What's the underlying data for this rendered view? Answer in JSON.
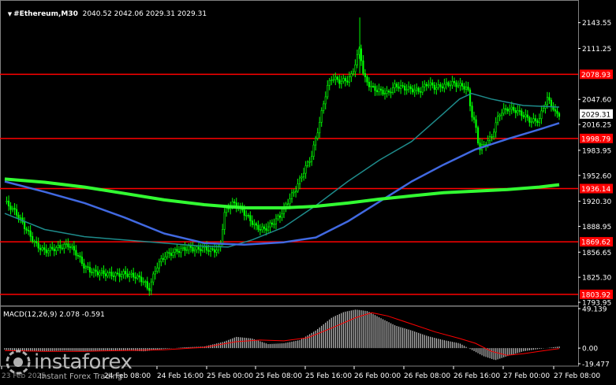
{
  "header": {
    "symbol": "#Ethereum,M30",
    "ohlc": "2040.52 2042.06 2029.31 2029.31"
  },
  "macd_header": "MACD(12,26,9) 2.078 -0.591",
  "watermark": {
    "brand": "instaforex",
    "tagline": "Instant Forex Trading"
  },
  "colors": {
    "background": "#000000",
    "candle": "#00ff00",
    "level_line": "#ff0000",
    "ma_fast": "#1e8b8b",
    "ma_mid": "#4169e1",
    "ma_slow": "#32ff32",
    "macd_hist": "#c0c0c0",
    "macd_signal": "#ff0000"
  },
  "chart_data": [
    {
      "type": "line",
      "subtype": "candlestick",
      "title": "#Ethereum,M30",
      "ylim": [
        1793.95,
        2160
      ],
      "y_ticks": [
        "2143.55",
        "2111.25",
        "2078.93",
        "2047.60",
        "2029.31",
        "2016.25",
        "1998.79",
        "1983.95",
        "1952.60",
        "1936.14",
        "1920.30",
        "1888.95",
        "1869.62",
        "1856.65",
        "1825.30",
        "1803.92",
        "1793.95"
      ],
      "x_ticks": [
        "23 Feb 2025",
        "24 Feb 08:00",
        "24 Feb 16:00",
        "25 Feb 00:00",
        "25 Feb 08:00",
        "25 Feb 16:00",
        "26 Feb 00:00",
        "26 Feb 08:00",
        "26 Feb 16:00",
        "27 Feb 00:00",
        "27 Feb 08:00"
      ],
      "price_path": [
        [
          0,
          1920
        ],
        [
          3,
          1905
        ],
        [
          6,
          1880
        ],
        [
          8,
          1865
        ],
        [
          10,
          1858
        ],
        [
          13,
          1862
        ],
        [
          16,
          1866
        ],
        [
          18,
          1855
        ],
        [
          20,
          1838
        ],
        [
          22,
          1832
        ],
        [
          25,
          1830
        ],
        [
          28,
          1828
        ],
        [
          30,
          1830
        ],
        [
          33,
          1826
        ],
        [
          35,
          1820
        ],
        [
          36,
          1808
        ],
        [
          38,
          1838
        ],
        [
          40,
          1852
        ],
        [
          43,
          1858
        ],
        [
          46,
          1862
        ],
        [
          48,
          1860
        ],
        [
          50,
          1862
        ],
        [
          52,
          1858
        ],
        [
          54,
          1862
        ],
        [
          55,
          1905
        ],
        [
          57,
          1918
        ],
        [
          59,
          1912
        ],
        [
          61,
          1900
        ],
        [
          63,
          1888
        ],
        [
          65,
          1885
        ],
        [
          67,
          1892
        ],
        [
          69,
          1902
        ],
        [
          71,
          1920
        ],
        [
          73,
          1936
        ],
        [
          75,
          1958
        ],
        [
          77,
          1978
        ],
        [
          78,
          2000
        ],
        [
          79,
          2020
        ],
        [
          80,
          2045
        ],
        [
          81,
          2065
        ],
        [
          82,
          2075
        ],
        [
          84,
          2070
        ],
        [
          86,
          2072
        ],
        [
          87,
          2078
        ],
        [
          88,
          2095
        ],
        [
          89,
          2112
        ],
        [
          90,
          2075
        ],
        [
          92,
          2062
        ],
        [
          94,
          2058
        ],
        [
          96,
          2055
        ],
        [
          98,
          2065
        ],
        [
          100,
          2062
        ],
        [
          102,
          2060
        ],
        [
          104,
          2058
        ],
        [
          106,
          2068
        ],
        [
          108,
          2062
        ],
        [
          110,
          2065
        ],
        [
          112,
          2068
        ],
        [
          114,
          2065
        ],
        [
          116,
          2062
        ],
        [
          117,
          2030
        ],
        [
          118,
          2015
        ],
        [
          119,
          1985
        ],
        [
          120,
          1990
        ],
        [
          122,
          2000
        ],
        [
          124,
          2030
        ],
        [
          126,
          2036
        ],
        [
          128,
          2034
        ],
        [
          130,
          2028
        ],
        [
          132,
          2020
        ],
        [
          134,
          2022
        ],
        [
          135,
          2038
        ],
        [
          136,
          2048
        ],
        [
          137,
          2042
        ],
        [
          138,
          2030
        ],
        [
          139,
          2029.31
        ]
      ],
      "series": [
        {
          "name": "MA fast",
          "values": [
            [
              0,
              1905
            ],
            [
              10,
              1885
            ],
            [
              20,
              1876
            ],
            [
              30,
              1872
            ],
            [
              40,
              1868
            ],
            [
              50,
              1864
            ],
            [
              56,
              1863
            ],
            [
              62,
              1872
            ],
            [
              70,
              1888
            ],
            [
              78,
              1915
            ],
            [
              86,
              1945
            ],
            [
              94,
              1972
            ],
            [
              102,
              1995
            ],
            [
              110,
              2030
            ],
            [
              114,
              2048
            ],
            [
              117,
              2055
            ],
            [
              122,
              2048
            ],
            [
              130,
              2040
            ],
            [
              139,
              2038
            ]
          ]
        },
        {
          "name": "MA mid",
          "values": [
            [
              0,
              1945
            ],
            [
              10,
              1932
            ],
            [
              20,
              1918
            ],
            [
              30,
              1900
            ],
            [
              40,
              1880
            ],
            [
              50,
              1868
            ],
            [
              60,
              1866
            ],
            [
              70,
              1869
            ],
            [
              78,
              1875
            ],
            [
              86,
              1895
            ],
            [
              94,
              1920
            ],
            [
              102,
              1945
            ],
            [
              110,
              1966
            ],
            [
              118,
              1985
            ],
            [
              126,
              1998
            ],
            [
              134,
              2010
            ],
            [
              139,
              2018
            ]
          ]
        },
        {
          "name": "MA slow",
          "values": [
            [
              0,
              1948
            ],
            [
              10,
              1944
            ],
            [
              20,
              1938
            ],
            [
              30,
              1930
            ],
            [
              40,
              1922
            ],
            [
              50,
              1916
            ],
            [
              60,
              1912
            ],
            [
              70,
              1912
            ],
            [
              78,
              1914
            ],
            [
              86,
              1918
            ],
            [
              94,
              1923
            ],
            [
              102,
              1927
            ],
            [
              110,
              1931
            ],
            [
              118,
              1933
            ],
            [
              126,
              1935
            ],
            [
              134,
              1938
            ],
            [
              139,
              1941
            ]
          ]
        }
      ],
      "levels": [
        2078.93,
        1998.79,
        1936.14,
        1869.62,
        1803.92
      ],
      "level_labels": [
        "2078.93",
        "1998.79",
        "1936.14",
        "1869.62",
        "1803.92"
      ],
      "current_price_label": "2029.31"
    },
    {
      "type": "bar",
      "title": "MACD(12,26,9) 2.078 -0.591",
      "ylim": [
        -19.477,
        49.139
      ],
      "y_ticks": [
        "49.139",
        "0.00",
        "-19.477"
      ],
      "histogram": [
        [
          0,
          -2
        ],
        [
          5,
          -4
        ],
        [
          10,
          -4
        ],
        [
          15,
          -3
        ],
        [
          20,
          -4
        ],
        [
          25,
          -3
        ],
        [
          30,
          -3
        ],
        [
          35,
          -4
        ],
        [
          40,
          -1
        ],
        [
          45,
          1
        ],
        [
          50,
          2
        ],
        [
          55,
          8
        ],
        [
          58,
          14
        ],
        [
          62,
          12
        ],
        [
          66,
          5
        ],
        [
          70,
          6
        ],
        [
          74,
          10
        ],
        [
          78,
          22
        ],
        [
          82,
          38
        ],
        [
          85,
          45
        ],
        [
          88,
          48
        ],
        [
          91,
          46
        ],
        [
          94,
          38
        ],
        [
          98,
          28
        ],
        [
          102,
          22
        ],
        [
          106,
          15
        ],
        [
          110,
          10
        ],
        [
          114,
          6
        ],
        [
          117,
          -2
        ],
        [
          120,
          -10
        ],
        [
          123,
          -15
        ],
        [
          126,
          -10
        ],
        [
          130,
          -4
        ],
        [
          134,
          -1
        ],
        [
          139,
          2
        ]
      ],
      "signal": [
        [
          0,
          -3
        ],
        [
          10,
          -4
        ],
        [
          20,
          -4
        ],
        [
          30,
          -3
        ],
        [
          40,
          -2
        ],
        [
          50,
          1
        ],
        [
          58,
          8
        ],
        [
          64,
          10
        ],
        [
          70,
          9
        ],
        [
          76,
          13
        ],
        [
          82,
          25
        ],
        [
          88,
          38
        ],
        [
          92,
          44
        ],
        [
          96,
          40
        ],
        [
          102,
          30
        ],
        [
          108,
          20
        ],
        [
          114,
          12
        ],
        [
          118,
          6
        ],
        [
          122,
          -4
        ],
        [
          126,
          -9
        ],
        [
          130,
          -7
        ],
        [
          134,
          -4
        ],
        [
          139,
          -0.6
        ]
      ]
    }
  ]
}
